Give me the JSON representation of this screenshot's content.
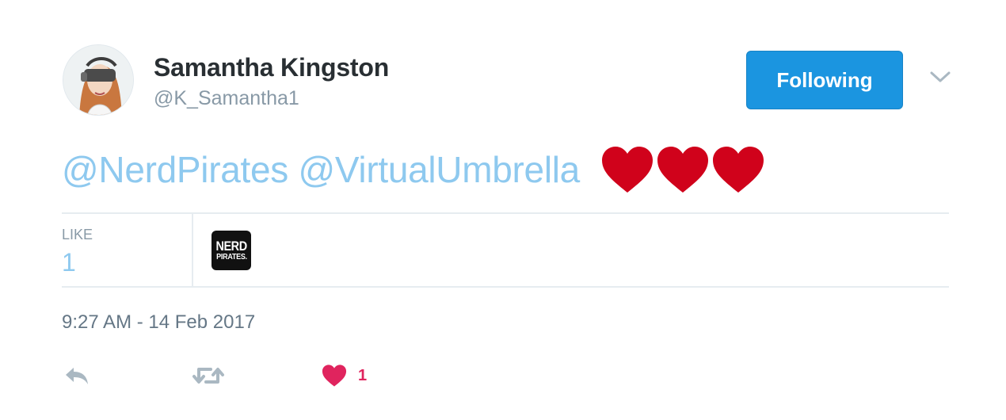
{
  "author": {
    "name": "Samantha Kingston",
    "handle": "@K_Samantha1"
  },
  "follow_button": {
    "label": "Following"
  },
  "tweet": {
    "mentions": [
      "@NerdPirates",
      "@VirtualUmbrella"
    ],
    "emoji": [
      "red-heart",
      "red-heart",
      "red-heart"
    ]
  },
  "stats": {
    "likes_label": "LIKE",
    "likes_value": "1"
  },
  "likers": [
    {
      "logo_line1": "NERD",
      "logo_line2": "PIRATES."
    }
  ],
  "timestamp": "9:27 AM - 14 Feb 2017",
  "actions": {
    "like_count": "1"
  },
  "colors": {
    "follow_blue": "#1b95e0",
    "mention_blue": "#8ec9ef",
    "heart_red": "#d0021b",
    "like_red": "#e0245e",
    "muted_gray": "#8899a6"
  }
}
